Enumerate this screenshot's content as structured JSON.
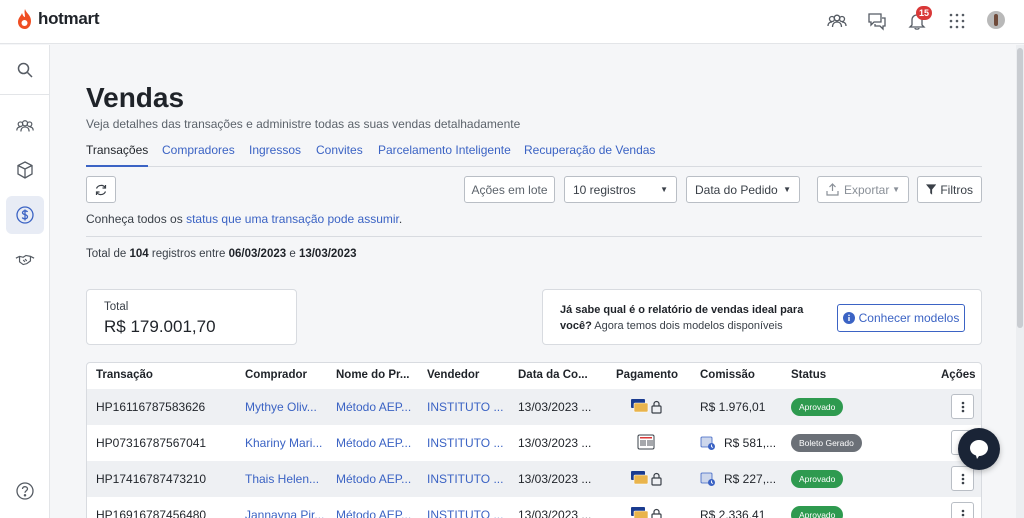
{
  "app": {
    "brand": "hotmart",
    "brand_color": "#ef4e23",
    "accent": "#3b63c4"
  },
  "topbar": {
    "notification_count": "15"
  },
  "page": {
    "title": "Vendas",
    "subtitle": "Veja detalhes das transações e administre todas as suas vendas detalhadamente",
    "tabs": [
      {
        "label": "Transações",
        "active": true
      },
      {
        "label": "Compradores"
      },
      {
        "label": "Ingressos"
      },
      {
        "label": "Convites"
      },
      {
        "label": "Parcelamento Inteligente"
      },
      {
        "label": "Recuperação de Vendas"
      }
    ]
  },
  "toolbar": {
    "bulk_actions": "Ações em lote",
    "records": "10 registros",
    "date_filter": "Data do Pedido",
    "export": "Exportar",
    "filters": "Filtros"
  },
  "info": {
    "prefix": "Conheça todos os ",
    "link": "status que uma transação pode assumir",
    "suffix": "."
  },
  "summary": {
    "t1": "Total de ",
    "count": "104",
    "t2": " registros entre ",
    "start": "06/03/2023",
    "t3": " e ",
    "end": "13/03/2023"
  },
  "total_card": {
    "label": "Total",
    "value": "R$ 179.001,70"
  },
  "report_card": {
    "bold": "Já sabe qual é o relatório de vendas ideal para você?",
    "text": " Agora temos dois modelos disponíveis",
    "button": "Conhecer modelos"
  },
  "table": {
    "headers": [
      "Transação",
      "Comprador",
      "Nome do Pr...",
      "Vendedor",
      "Data da Co...",
      "Pagamento",
      "Comissão",
      "Status",
      "Ações"
    ],
    "rows": [
      {
        "transaction": "HP16116787583626",
        "buyer": "Mythye Oliv...",
        "product": "Método AEP...",
        "seller": "INSTITUTO ...",
        "date": "13/03/2023 ...",
        "commission": "R$ 1.976,01",
        "status": "Aprovado",
        "status_color": "#2e9a4f"
      },
      {
        "transaction": "HP07316787567041",
        "buyer": "Khariny Mari...",
        "product": "Método AEP...",
        "seller": "INSTITUTO ...",
        "date": "13/03/2023 ...",
        "commission": "R$ 581,...",
        "status": "Boleto Gerado",
        "status_color": "#6b7077"
      },
      {
        "transaction": "HP17416787473210",
        "buyer": "Thais Helen...",
        "product": "Método AEP...",
        "seller": "INSTITUTO ...",
        "date": "13/03/2023 ...",
        "commission": "R$ 227,...",
        "status": "Aprovado",
        "status_color": "#2e9a4f"
      },
      {
        "transaction": "HP16916787456480",
        "buyer": "Jannayna Pir...",
        "product": "Método AEP...",
        "seller": "INSTITUTO ...",
        "date": "13/03/2023 ...",
        "commission": "R$ 2.336,41",
        "status": "Aprovado",
        "status_color": "#2e9a4f"
      }
    ]
  }
}
